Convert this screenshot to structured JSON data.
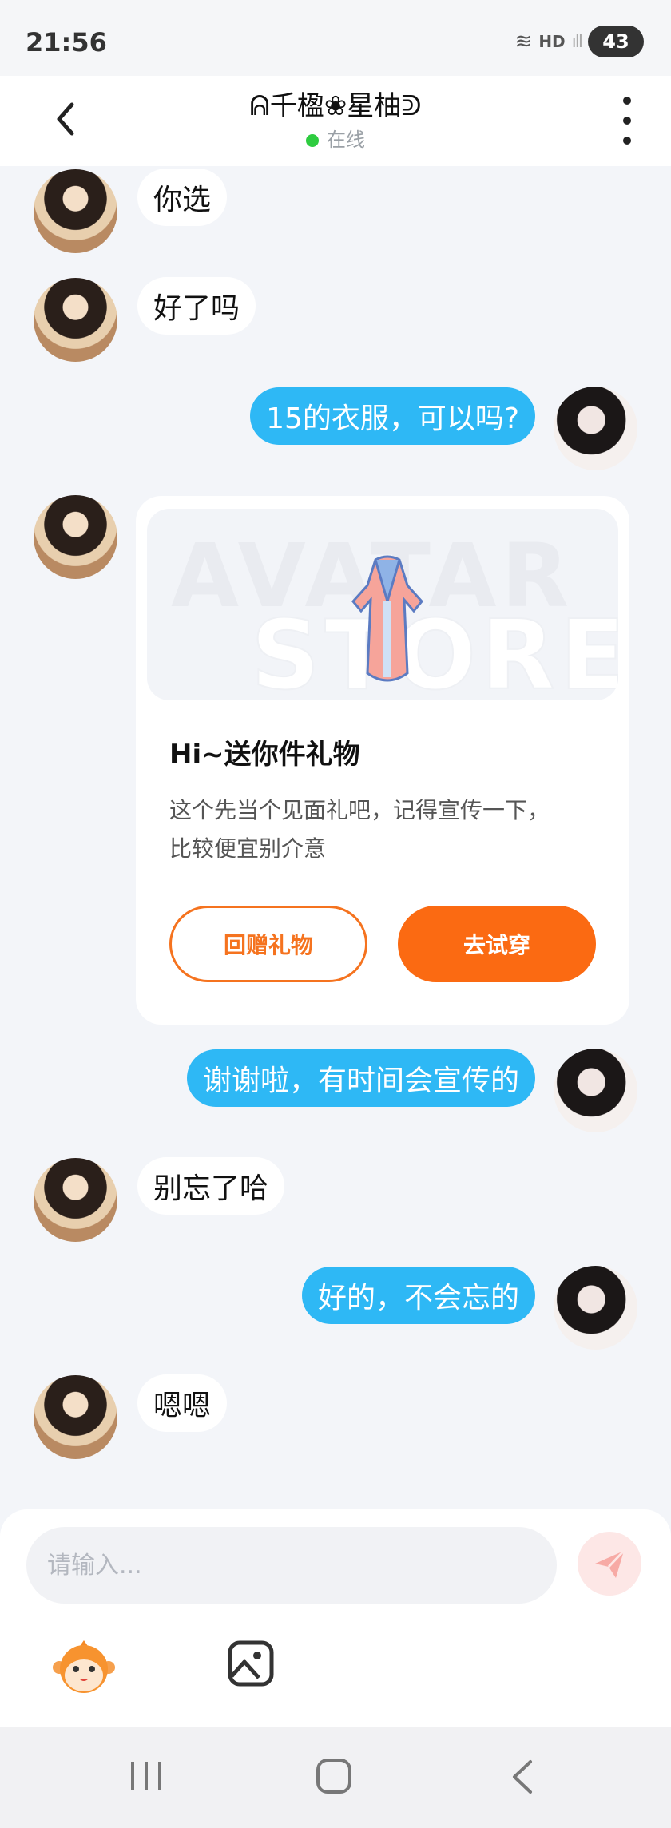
{
  "status_bar": {
    "time": "21:56",
    "network": "HD",
    "battery": "43"
  },
  "header": {
    "title": "ᕱ千楹❀星柚ᕲ",
    "status": "在线"
  },
  "messages": [
    {
      "side": "in",
      "text": "你选"
    },
    {
      "side": "in",
      "text": "好了吗"
    },
    {
      "side": "out",
      "text": "15的衣服，可以吗?"
    },
    {
      "side": "out",
      "text": "谢谢啦，有时间会宣传的"
    },
    {
      "side": "in",
      "text": "别忘了哈"
    },
    {
      "side": "out",
      "text": "好的，不会忘的"
    },
    {
      "side": "in",
      "text": "嗯嗯"
    }
  ],
  "gift_card": {
    "watermark_top": "AVATAR",
    "watermark_bottom": "STORE",
    "title": "Hi~送你件礼物",
    "desc_line1": "这个先当个见面礼吧，记得宣传一下，",
    "desc_line2": "比较便宜别介意",
    "return_label": "回赠礼物",
    "try_label": "去试穿"
  },
  "composer": {
    "placeholder": "请输入..."
  },
  "colors": {
    "accent_blue": "#2eb8f5",
    "accent_orange": "#fb6a12",
    "online_green": "#2ecc40"
  },
  "icons": {
    "back": "chevron-left-icon",
    "more": "more-vertical-icon",
    "send": "send-icon",
    "emoji": "monkey-emoji-icon",
    "image": "image-icon",
    "nav_recent": "recent-apps-icon",
    "nav_home": "home-icon",
    "nav_back": "nav-back-icon"
  }
}
